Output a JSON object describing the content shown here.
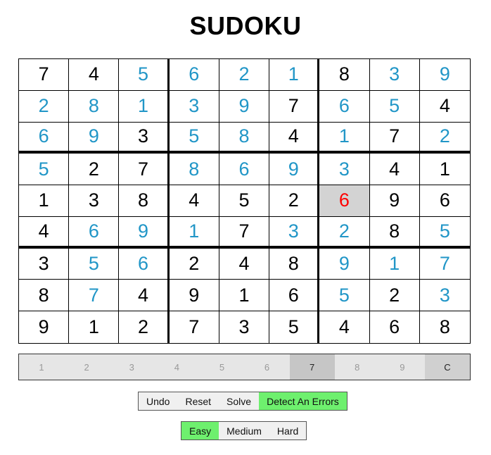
{
  "title": "SUDOKU",
  "colors": {
    "given": "#000000",
    "user_entry": "#2196c7",
    "error": "#ff0000",
    "selected_bg": "#d3d3d3",
    "active_toggle": "#6ef06e"
  },
  "board": [
    [
      "7",
      "4",
      "5",
      "6",
      "2",
      "1",
      "8",
      "3",
      "9"
    ],
    [
      "2",
      "8",
      "1",
      "3",
      "9",
      "7",
      "6",
      "5",
      "4"
    ],
    [
      "6",
      "9",
      "3",
      "5",
      "8",
      "4",
      "1",
      "7",
      "2"
    ],
    [
      "5",
      "2",
      "7",
      "8",
      "6",
      "9",
      "3",
      "4",
      "1"
    ],
    [
      "1",
      "3",
      "8",
      "4",
      "5",
      "2",
      "6",
      "9",
      "6"
    ],
    [
      "4",
      "6",
      "9",
      "1",
      "7",
      "3",
      "2",
      "8",
      "5"
    ],
    [
      "3",
      "5",
      "6",
      "2",
      "4",
      "8",
      "9",
      "1",
      "7"
    ],
    [
      "8",
      "7",
      "4",
      "9",
      "1",
      "6",
      "5",
      "2",
      "3"
    ],
    [
      "9",
      "1",
      "2",
      "7",
      "3",
      "5",
      "4",
      "6",
      "8"
    ]
  ],
  "cell_type": [
    [
      "g",
      "g",
      "u",
      "u",
      "u",
      "u",
      "g",
      "u",
      "u"
    ],
    [
      "u",
      "u",
      "u",
      "u",
      "u",
      "g",
      "u",
      "u",
      "g"
    ],
    [
      "u",
      "u",
      "g",
      "u",
      "u",
      "g",
      "u",
      "g",
      "u"
    ],
    [
      "u",
      "g",
      "g",
      "u",
      "u",
      "u",
      "u",
      "g",
      "g"
    ],
    [
      "g",
      "g",
      "g",
      "g",
      "g",
      "g",
      "u",
      "g",
      "g"
    ],
    [
      "g",
      "u",
      "u",
      "u",
      "g",
      "u",
      "u",
      "g",
      "u"
    ],
    [
      "g",
      "u",
      "u",
      "g",
      "g",
      "g",
      "u",
      "u",
      "u"
    ],
    [
      "g",
      "u",
      "g",
      "g",
      "g",
      "g",
      "u",
      "g",
      "u"
    ],
    [
      "g",
      "g",
      "g",
      "g",
      "g",
      "g",
      "g",
      "g",
      "g"
    ]
  ],
  "selected_cell": {
    "row": 5,
    "col": 7,
    "error": true
  },
  "numpad": {
    "keys": [
      "1",
      "2",
      "3",
      "4",
      "5",
      "6",
      "7",
      "8",
      "9",
      "C"
    ],
    "active_key": "7"
  },
  "controls": {
    "undo": "Undo",
    "reset": "Reset",
    "solve": "Solve",
    "detect": "Detect An Errors",
    "detect_active": true
  },
  "difficulty": {
    "easy": "Easy",
    "medium": "Medium",
    "hard": "Hard",
    "selected": "Easy"
  }
}
